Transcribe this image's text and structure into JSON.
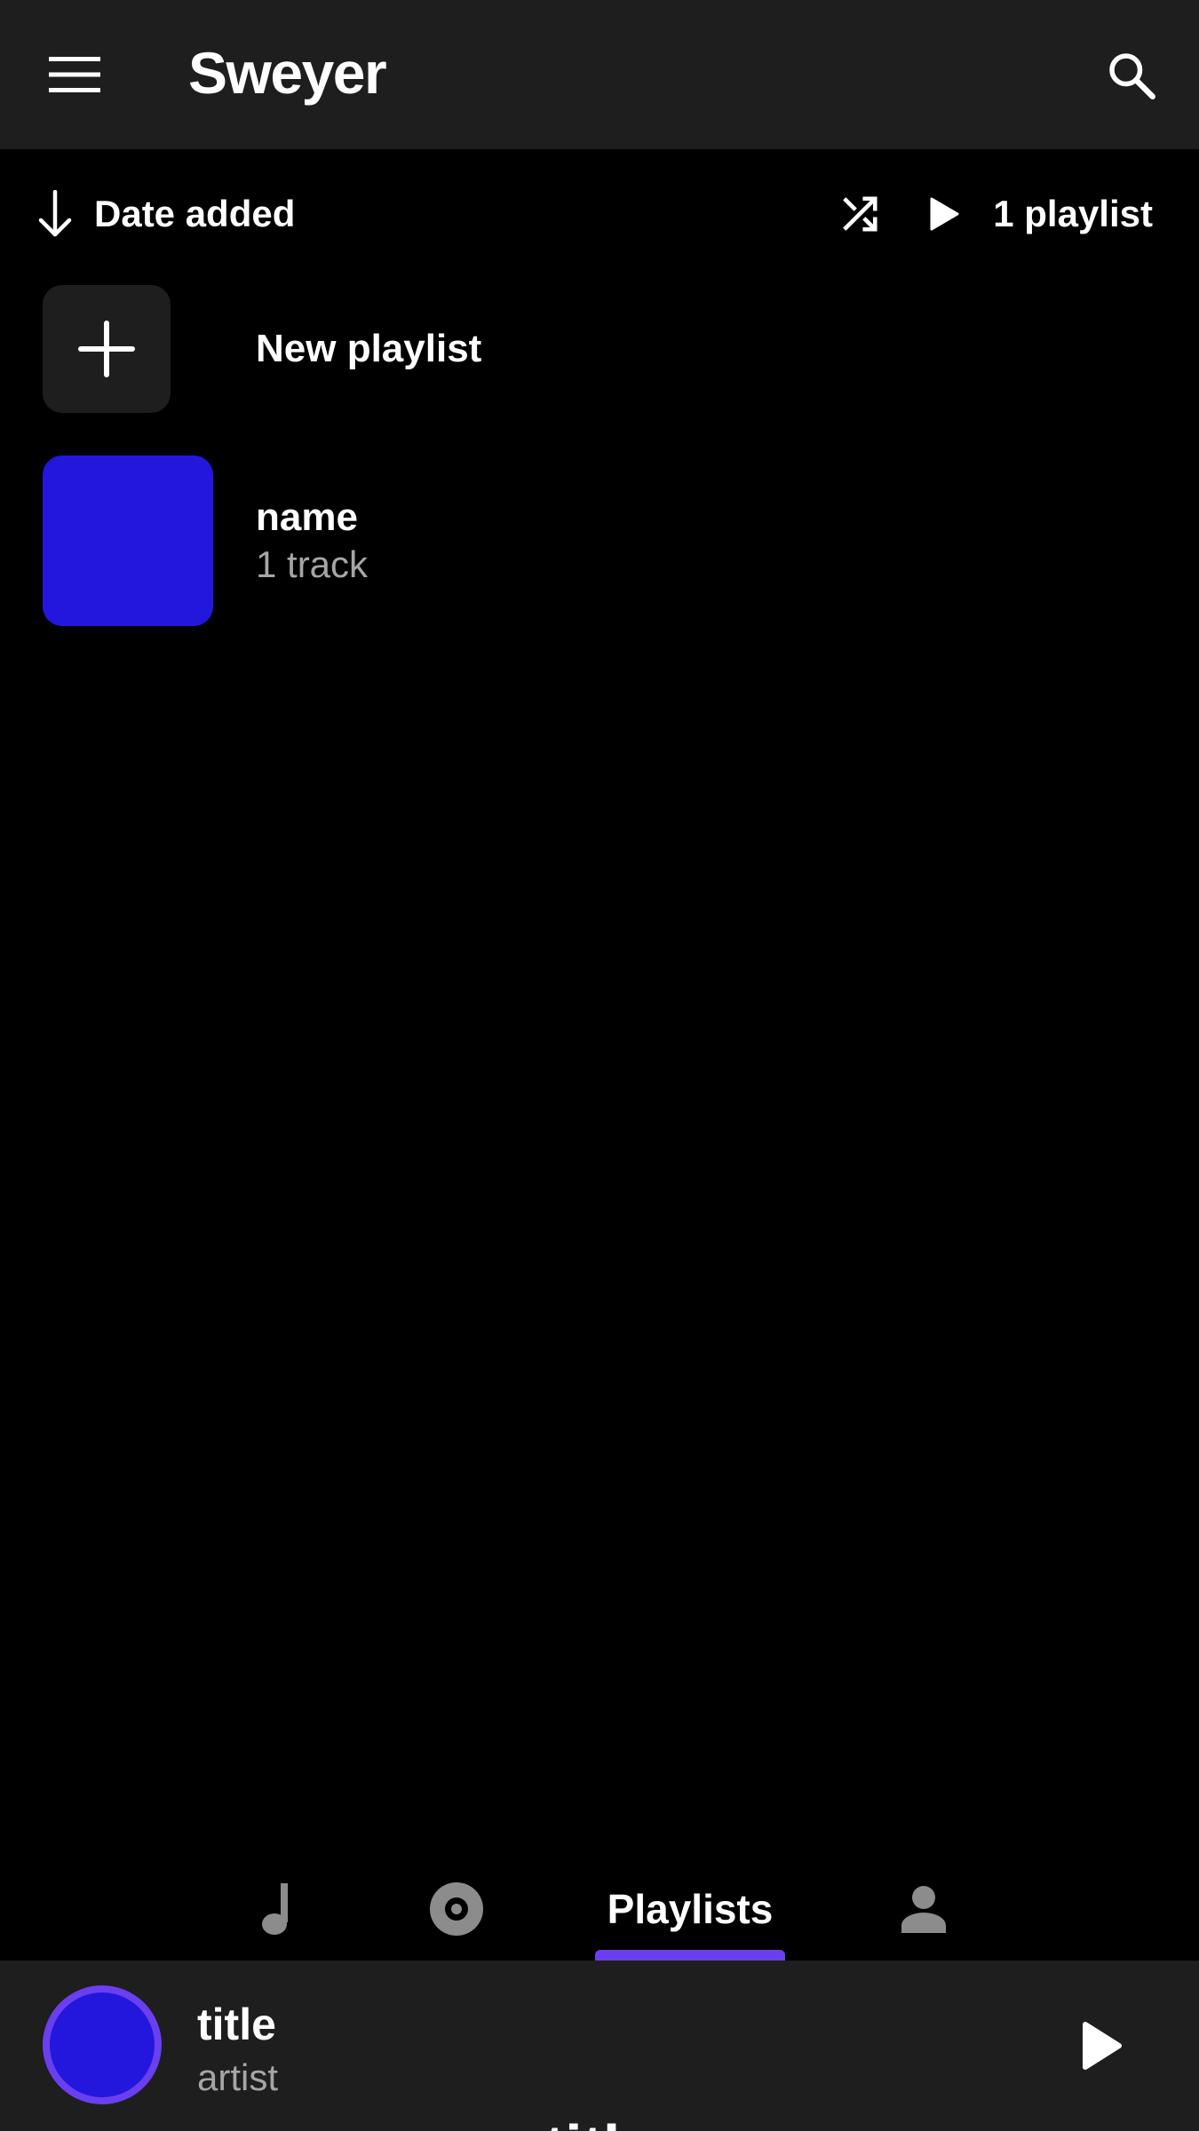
{
  "app": {
    "title": "Sweyer",
    "icons": {
      "menu": "menu-icon",
      "search": "search-icon"
    }
  },
  "toolbar": {
    "sort_label": "Date added",
    "sort_direction": "descending",
    "sort_icon": "arrow-down-icon",
    "shuffle_icon": "shuffle-icon",
    "play_icon": "play-icon",
    "count_label": "1 playlist"
  },
  "new_playlist": {
    "label": "New playlist",
    "icon": "plus-icon"
  },
  "playlists": [
    {
      "name": "name",
      "subtitle": "1 track",
      "art_color": "#2317dd"
    }
  ],
  "tabs": {
    "active": "Playlists",
    "items": [
      {
        "key": "songs",
        "icon": "music-note-icon",
        "label": ""
      },
      {
        "key": "albums",
        "icon": "album-icon",
        "label": ""
      },
      {
        "key": "playlists",
        "icon": "",
        "label": "Playlists"
      },
      {
        "key": "artists",
        "icon": "person-icon",
        "label": ""
      }
    ]
  },
  "player": {
    "title": "title",
    "artist": "artist",
    "expanded_title_peek": "title",
    "play_icon": "play-icon",
    "art_color": "#2317dd"
  },
  "colors": {
    "background": "#000000",
    "surface": "#1e1e1e",
    "accent": "#6a3ff0",
    "art": "#2317dd",
    "inactive_icon": "#8c8c8c",
    "secondary_text": "#a6a6a6"
  }
}
